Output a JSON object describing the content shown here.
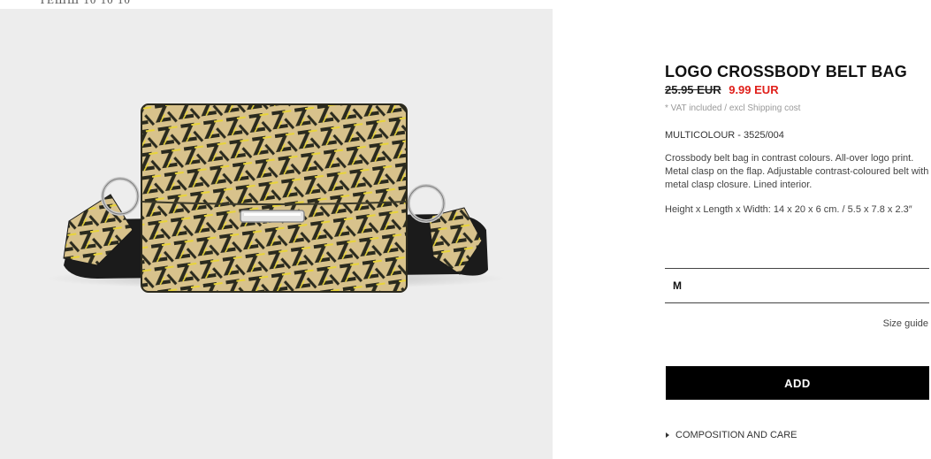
{
  "header": {
    "crop_text": "ТЕШШ 10 10 10"
  },
  "product": {
    "title": "LOGO CROSSBODY BELT BAG",
    "old_price": "25.95 EUR",
    "new_price": "9.99 EUR",
    "vat_note": "* VAT included / excl Shipping cost",
    "color_ref": "MULTICOLOUR - 3525/004",
    "description": "Crossbody belt bag in contrast colours. All-over logo print. Metal clasp on the flap. Adjustable contrast-coloured belt with metal clasp closure. Lined interior.",
    "dimensions": "Height x Length x Width: 14 x 20 x 6 cm. / 5.5 x 7.8 x 2.3″"
  },
  "size_selector": {
    "selected": "M"
  },
  "size_guide_label": "Size guide",
  "add_button_label": "ADD",
  "composition_label": "COMPOSITION AND CARE",
  "colors": {
    "price_sale": "#e0201b",
    "bag_base": "#d8c28c",
    "bag_print": "#2a2a1e",
    "bag_accent": "#e8d43a"
  }
}
